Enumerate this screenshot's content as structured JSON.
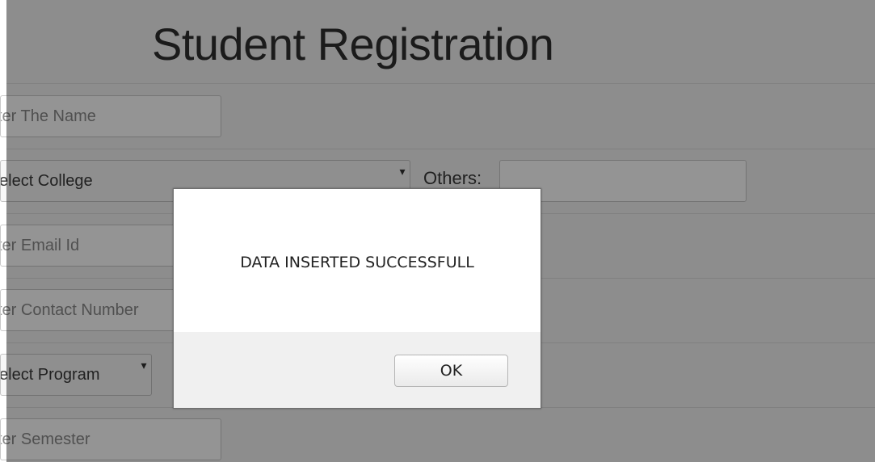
{
  "form": {
    "title": "Student Registration",
    "name_placeholder": "ter The Name",
    "college_select": "elect College",
    "others_label": "Others:",
    "email_placeholder": "ter Email Id",
    "contact_placeholder": "ter Contact Number",
    "program_select": "elect Program",
    "semester_placeholder": "ter Semester"
  },
  "dialog": {
    "message": "DATA INSERTED SUCCESSFULL",
    "ok_label": "OK"
  },
  "icons": {
    "select_arrow": "dropdown-arrow-icon"
  }
}
